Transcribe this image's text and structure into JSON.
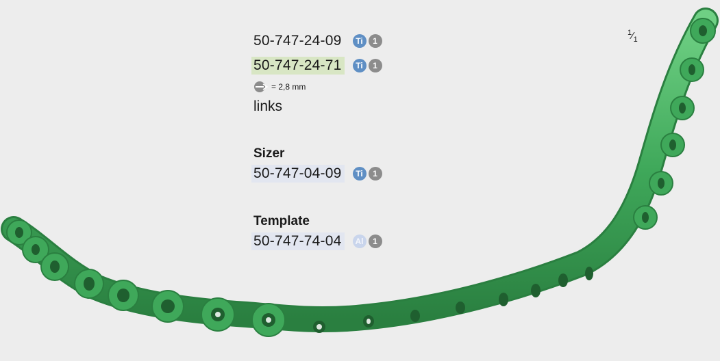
{
  "items": {
    "implant_1": {
      "code": "50-747-24-09",
      "material": "Ti",
      "quantity": "1"
    },
    "implant_2": {
      "code": "50-747-24-71",
      "material": "Ti",
      "quantity": "1"
    }
  },
  "drill": {
    "icon": "drill-icon",
    "text": "= 2,8 mm"
  },
  "side_label": "links",
  "sizer": {
    "heading": "Sizer",
    "code": "50-747-04-09",
    "material": "Ti",
    "quantity": "1"
  },
  "template": {
    "heading": "Template",
    "code": "50-747-74-04",
    "material": "Al",
    "quantity": "1"
  },
  "scale": {
    "numerator": "1",
    "denominator": "1"
  },
  "colors": {
    "implant_green": "#3fa85a",
    "ti_badge": "#5f8fc4",
    "al_badge": "#c9d5ec",
    "highlight_green": "#d8e6c4",
    "highlight_blue": "#e2e6f0"
  }
}
